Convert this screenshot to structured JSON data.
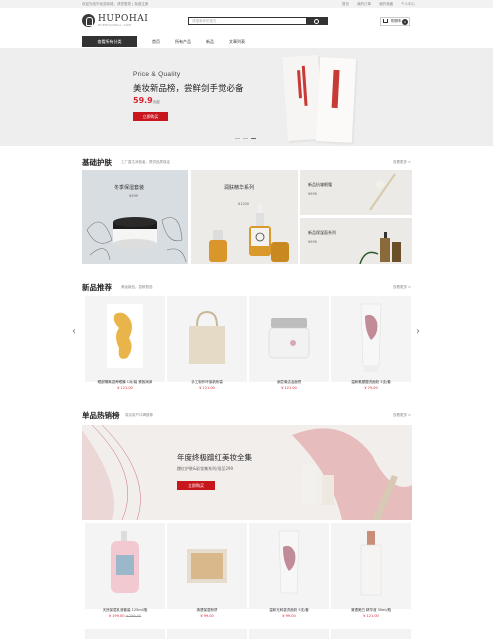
{
  "topbar": {
    "welcome": "欢迎光临华优选商城，请您登录 | 免费注册",
    "links": [
      "首页",
      "我的订单",
      "我的收藏",
      "个人中心"
    ]
  },
  "logo": {
    "name": "HUPOHAI",
    "sub": "HUPOHAIMALL.COM"
  },
  "search": {
    "placeholder": "请搜索你的宝贝"
  },
  "cart": {
    "label": "购物车",
    "count": "0"
  },
  "nav": {
    "category": "查看所有分类",
    "links": [
      "首页",
      "所有产品",
      "新品",
      "文章列表"
    ]
  },
  "hero": {
    "tagline": "Price & Quality",
    "headline": "美妆新品榜，尝鲜剑手觉必备",
    "price": "59.9",
    "price_unit": "元起",
    "button": "立即购买"
  },
  "basic": {
    "title": "基础护肤",
    "subtitle": "工厂直达消费者，提供品质保证",
    "more": "查看更多 >",
    "tiles": [
      {
        "title": "冬季保湿套装",
        "price": "¥599"
      },
      {
        "title": "润肤精华系列",
        "price": "¥1200"
      },
      {
        "title": "新品抗皱眼霜",
        "price": "¥599"
      },
      {
        "title": "新品保湿面系列",
        "price": "¥599"
      }
    ]
  },
  "newprod": {
    "title": "新品推荐",
    "subtitle": "美妆新品，尝鲜首选",
    "more": "查看更多 >",
    "items": [
      {
        "name": "眼部隔离滋养眼膜 1对/装 紧致润泽",
        "price": "¥ 121.00"
      },
      {
        "name": "手工制作环保帆布袋",
        "price": "¥ 121.00"
      },
      {
        "name": "深层清洁洁面膏",
        "price": "¥ 121.00"
      },
      {
        "name": "温和氨基酸洗面奶 5支/套",
        "price": "¥ 79.00"
      }
    ]
  },
  "hot": {
    "title": "单品热销榜",
    "subtitle": "真实用户口碑推荐",
    "more": "查看更多 >",
    "banner_title": "年度终极蹭红美妆全集",
    "banner_sub": "蹭红护肤&彩妆集系列/低至299",
    "banner_btn": "立即购买",
    "items": [
      {
        "name": "天然保湿乳液套装 125ml/瓶",
        "price": "¥ 199.00",
        "old": "¥ 299.00"
      },
      {
        "name": "清透保湿粉饼",
        "price": "¥ 99.00"
      },
      {
        "name": "温和无刺激洗面奶 5支/套",
        "price": "¥ 99.00"
      },
      {
        "name": "清透美白 精华液 30ml/瓶",
        "price": "¥ 121.00"
      }
    ]
  }
}
